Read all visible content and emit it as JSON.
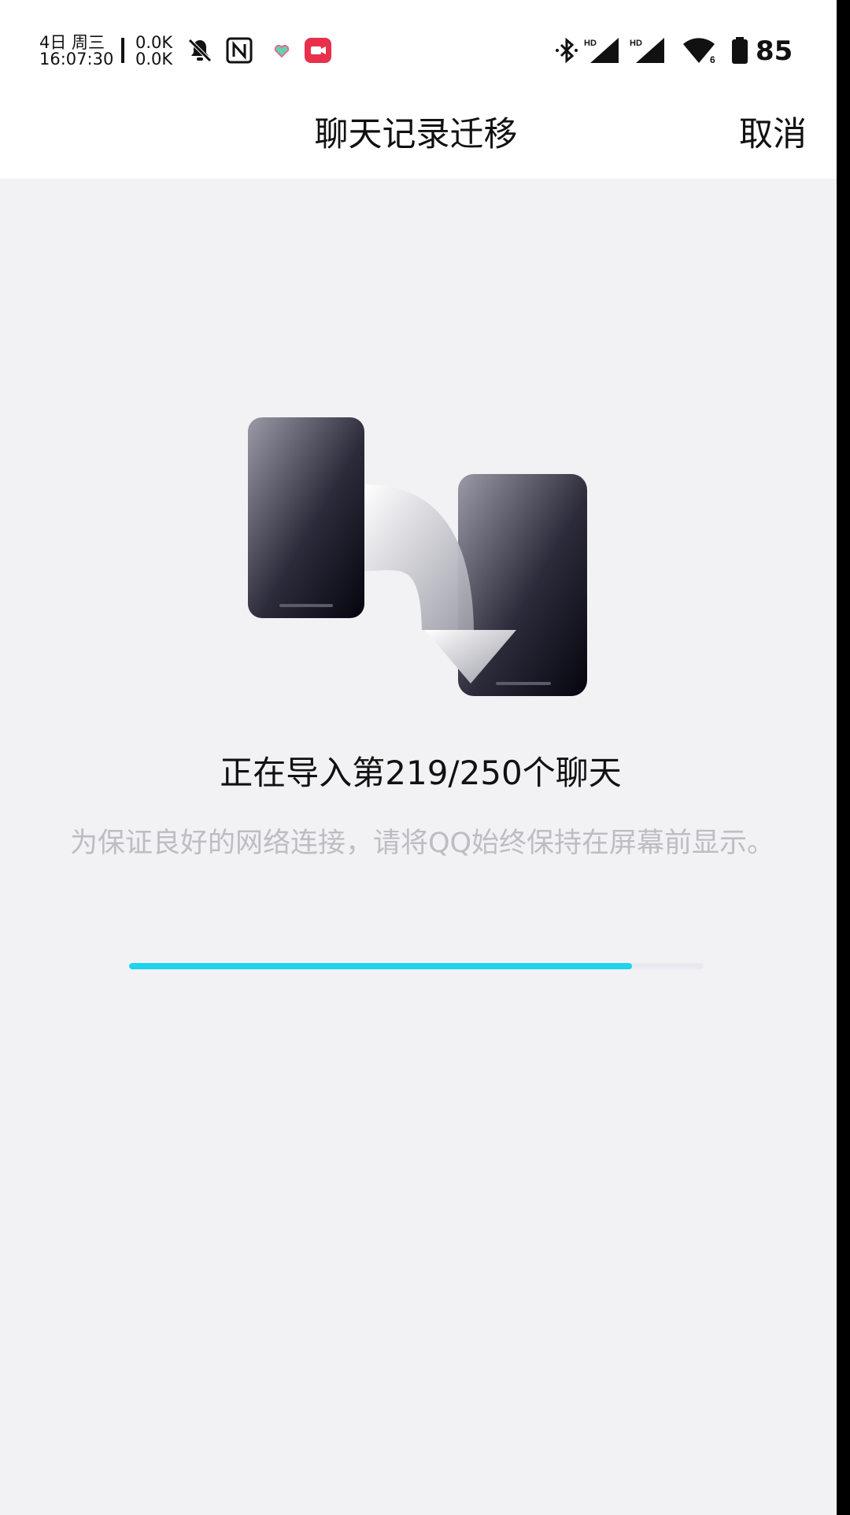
{
  "status_bar": {
    "date": "4日 周三",
    "time": "16:07:30",
    "net_up": "0.0K",
    "net_down": "0.0K",
    "icons": [
      "bell-off-icon",
      "nfc-icon",
      "heart-icon",
      "video-record-icon",
      "bluetooth-icon",
      "signal-hd-icon",
      "signal-hd-icon",
      "wifi-icon",
      "battery-icon"
    ],
    "signal_label_1": "HD",
    "signal_label_2": "HD",
    "wifi_label": "6",
    "battery": "85"
  },
  "nav": {
    "title": "聊天记录迁移",
    "cancel_label": "取消"
  },
  "main": {
    "progress_text": "正在导入第219/250个聊天",
    "hint_text": "为保证良好的网络连接，请将QQ始终保持在屏幕前显示。",
    "progress": {
      "current": 219,
      "total": 250,
      "fill_fraction": 0.876
    }
  },
  "colors": {
    "background": "#F2F2F4",
    "accent": "#1FD3EC",
    "hint": "#BDBDC2",
    "text": "#111111"
  }
}
